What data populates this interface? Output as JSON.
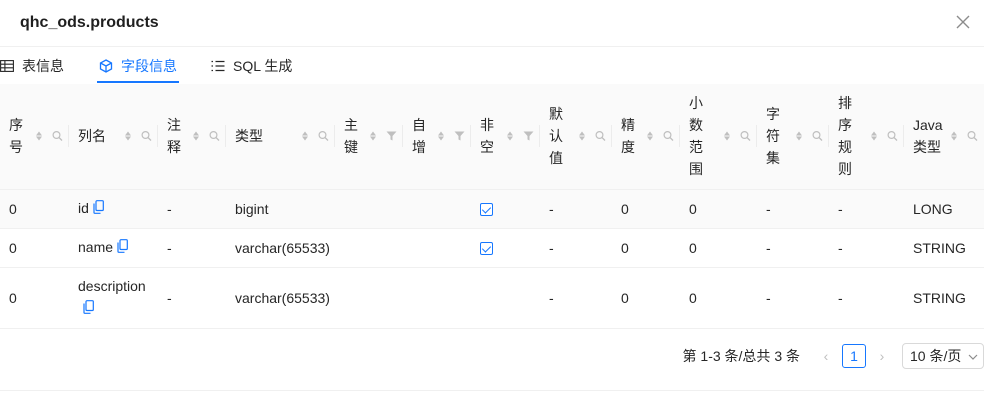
{
  "modal": {
    "title": "qhc_ods.products"
  },
  "tabs": [
    {
      "label": "表信息",
      "icon": "table-icon"
    },
    {
      "label": "字段信息",
      "icon": "fields-icon"
    },
    {
      "label": "SQL 生成",
      "icon": "list-icon"
    }
  ],
  "table": {
    "columns": [
      {
        "key": "seq",
        "label": "序\n号",
        "filter": "search"
      },
      {
        "key": "name",
        "label": "列名",
        "filter": "search"
      },
      {
        "key": "comment",
        "label": "注\n释",
        "filter": "search"
      },
      {
        "key": "type",
        "label": "类型",
        "filter": "search"
      },
      {
        "key": "pk",
        "label": "主\n键",
        "filter": "funnel"
      },
      {
        "key": "auto",
        "label": "自\n增",
        "filter": "funnel"
      },
      {
        "key": "notnull",
        "label": "非\n空",
        "filter": "funnel"
      },
      {
        "key": "default",
        "label": "默\n认\n值",
        "filter": "search"
      },
      {
        "key": "precision",
        "label": "精\n度",
        "filter": "search"
      },
      {
        "key": "scale",
        "label": "小\n数\n范\n围",
        "filter": "search"
      },
      {
        "key": "charset",
        "label": "字\n符\n集",
        "filter": "search"
      },
      {
        "key": "collation",
        "label": "排\n序\n规\n则",
        "filter": "search"
      },
      {
        "key": "java",
        "label": "Java\n类型",
        "filter": "search"
      }
    ],
    "rows": [
      {
        "seq": "0",
        "name": "id",
        "comment": "-",
        "type": "bigint",
        "pk": "",
        "auto": "",
        "notnull": true,
        "default": "-",
        "precision": "0",
        "scale": "0",
        "charset": "-",
        "collation": "-",
        "java": "LONG"
      },
      {
        "seq": "0",
        "name": "name",
        "comment": "-",
        "type": "varchar(65533)",
        "pk": "",
        "auto": "",
        "notnull": true,
        "default": "-",
        "precision": "0",
        "scale": "0",
        "charset": "-",
        "collation": "-",
        "java": "STRING"
      },
      {
        "seq": "0",
        "name": "description",
        "comment": "-",
        "type": "varchar(65533)",
        "pk": "",
        "auto": "",
        "notnull": false,
        "default": "-",
        "precision": "0",
        "scale": "0",
        "charset": "-",
        "collation": "-",
        "java": "STRING"
      }
    ]
  },
  "pagination": {
    "total_text": "第 1-3 条/总共 3 条",
    "current_page": "1",
    "page_size": "10 条/页"
  },
  "colors": {
    "accent": "#1677ff",
    "header_bg": "#fafafa",
    "border": "#f0f0f0"
  }
}
